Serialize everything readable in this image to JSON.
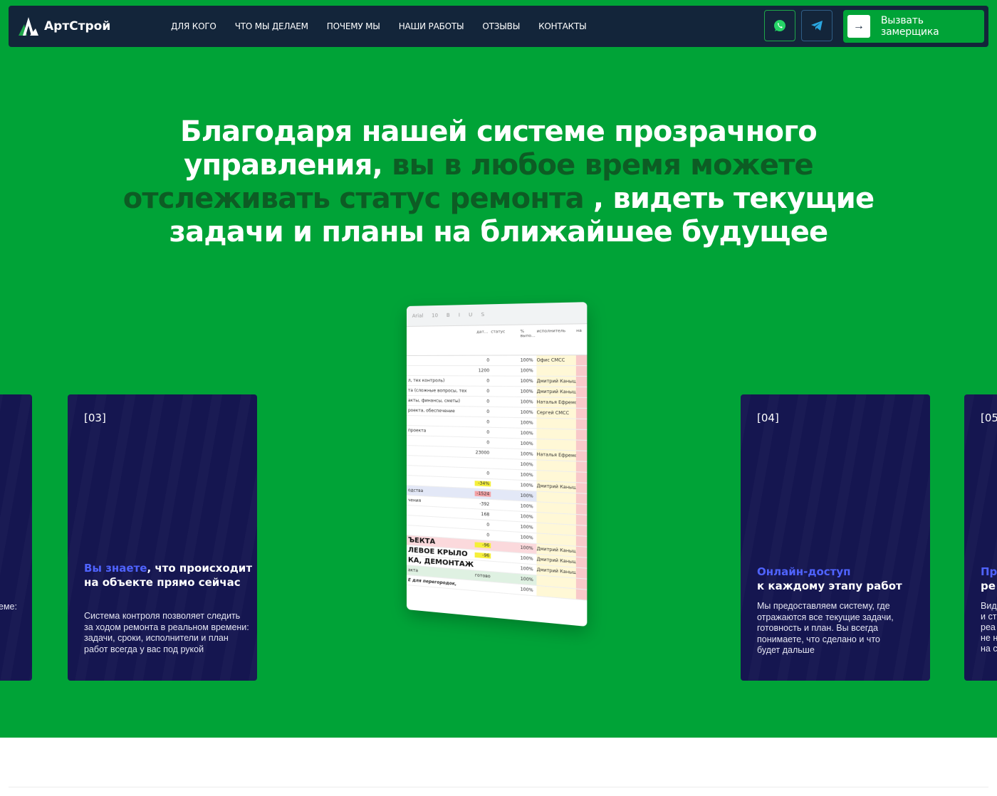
{
  "brand": {
    "name": "АртСтрой"
  },
  "nav": {
    "items": [
      "ДЛЯ КОГО",
      "ЧТО МЫ ДЕЛАЕМ",
      "ПОЧЕМУ МЫ",
      "НАШИ РАБОТЫ",
      "ОТЗЫВЫ",
      "КОНТАКТЫ"
    ]
  },
  "header": {
    "whatsapp_icon": "whatsapp-icon",
    "telegram_icon": "telegram-icon",
    "cta_arrow": "→",
    "cta_label": "Вызвать замерщика"
  },
  "hero": {
    "part1": "Благодаря нашей системе прозрачного управления, ",
    "accent": "вы в любое время можете отслеживать статус ремонта",
    "part2": " , видеть текущие задачи и планы на ближайшее будущее"
  },
  "cards": {
    "left_fragment": "еме:",
    "c03": {
      "num": "[03]",
      "title_hl": "Вы знаете",
      "title_rest": ", что происходит на объекте прямо сейчас",
      "desc": "Система контроля позволяет следить за ходом ремонта в реальном времени: задачи, сроки, исполнители и план работ всегда у вас под рукой"
    },
    "c04": {
      "num": "[04]",
      "title_hl": "Онлайн-доступ",
      "title_rest": "к каждому этапу работ",
      "desc": "Мы предоставляем систему, где отражаются все текущие задачи, готовность и план. Вы всегда понимаете, что сделано и что будет дальше"
    },
    "c05": {
      "num": "[05",
      "title_l1": "Пр",
      "title_l2": "ре",
      "desc_lines": [
        "Вид",
        "и ст",
        "реа",
        "не н",
        "на с"
      ]
    }
  },
  "sheet": {
    "toolbar": [
      "Arial",
      "10",
      "B",
      "I",
      "U",
      "S"
    ],
    "headers": [
      "дат...",
      "статус",
      "% выпо...",
      "исполнитель",
      "на"
    ],
    "office": "Офис СМСС",
    "rows": [
      {
        "label": "",
        "num": "0",
        "pct": "100%",
        "who": "Офис СМСС",
        "cls": ""
      },
      {
        "label": "",
        "num": "1200",
        "pct": "100%",
        "who": "",
        "cls": ""
      },
      {
        "label": "л, тех контроль)",
        "num": "0",
        "pct": "100%",
        "who": "Дмитрий Канышев",
        "cls": ""
      },
      {
        "label": "та (сложные вопросы, тех",
        "num": "0",
        "pct": "100%",
        "who": "Дмитрий Канышев",
        "cls": ""
      },
      {
        "label": "акты, финансы, сметы)",
        "num": "0",
        "pct": "100%",
        "who": "Наталья Ефремова",
        "cls": ""
      },
      {
        "label": "роекта, обеспечение",
        "num": "0",
        "pct": "100%",
        "who": "Сергей СМСС",
        "cls": ""
      },
      {
        "label": "",
        "num": "0",
        "pct": "100%",
        "who": "",
        "cls": ""
      },
      {
        "label": "проекта",
        "num": "0",
        "pct": "100%",
        "who": "",
        "cls": ""
      },
      {
        "label": "",
        "num": "0",
        "pct": "100%",
        "who": "",
        "cls": ""
      },
      {
        "label": "",
        "num": "23000",
        "pct": "100%",
        "who": "Наталья Ефремова",
        "cls": ""
      },
      {
        "label": "",
        "num": "",
        "pct": "100%",
        "who": "",
        "cls": "yel"
      },
      {
        "label": "",
        "num": "0",
        "pct": "100%",
        "who": "",
        "cls": ""
      },
      {
        "label": "",
        "num": "-34%",
        "pct": "100%",
        "who": "Дмитрий Канышев",
        "cls": "yel"
      },
      {
        "label": "одства",
        "num": "-1524",
        "pct": "100%",
        "who": "",
        "cls": "red"
      },
      {
        "label": "чения",
        "num": "-392",
        "pct": "100%",
        "who": "",
        "cls": ""
      },
      {
        "label": "",
        "num": "168",
        "pct": "100%",
        "who": "",
        "cls": ""
      },
      {
        "label": "",
        "num": "0",
        "pct": "100%",
        "who": "",
        "cls": ""
      },
      {
        "label": "",
        "num": "0",
        "pct": "100%",
        "who": "",
        "cls": ""
      },
      {
        "label": "ЪЕКТА",
        "num": "-96",
        "pct": "100%",
        "who": "Дмитрий Канышев",
        "cls": "pinkbig"
      },
      {
        "label": "ЛЕВОЕ КРЫЛО",
        "num": "-96",
        "pct": "100%",
        "who": "Дмитрий Канышев",
        "cls": "yelbig"
      },
      {
        "label": "КА, ДЕМОНТАЖ",
        "num": "",
        "pct": "100%",
        "who": "Дмитрий Канышев",
        "cls": "bold"
      },
      {
        "label": "акта",
        "num": "готово",
        "pct": "100%",
        "who": "",
        "cls": "grn"
      },
      {
        "label": "Е для перегородок,",
        "num": "",
        "pct": "100%",
        "who": "",
        "cls": "ital"
      }
    ]
  },
  "colors": {
    "hero_bg": "#00a337",
    "accent_text": "#0d5c24",
    "nav_bg": "#13253a",
    "card_bg": "#151650",
    "card_highlight": "#4f63ff"
  }
}
